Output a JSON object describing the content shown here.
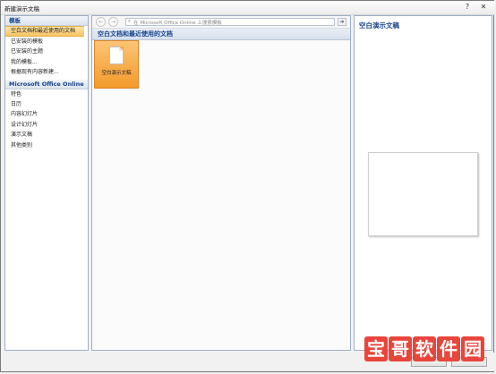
{
  "window": {
    "title": "新建演示文稿",
    "help_glyph": "?",
    "close_glyph": "✕"
  },
  "sidebar": {
    "templates_header": "模板",
    "items": [
      {
        "label": "空白文档和最近使用的文档",
        "selected": true
      },
      {
        "label": "已安装的模板"
      },
      {
        "label": "已安装的主题"
      },
      {
        "label": "我的模板..."
      },
      {
        "label": "根据现有内容新建..."
      }
    ],
    "online_header": "Microsoft Office Online",
    "online_items": [
      {
        "label": "特色"
      },
      {
        "label": "日历"
      },
      {
        "label": "内容幻灯片"
      },
      {
        "label": "设计幻灯片"
      },
      {
        "label": "演示文稿"
      },
      {
        "label": "其他类别"
      }
    ]
  },
  "toolbar": {
    "back_glyph": "←",
    "forward_glyph": "→",
    "search_icon": "magnifier-icon",
    "search_placeholder": "在 Microsoft Office Online 上搜索模板",
    "go_glyph": "➔"
  },
  "main": {
    "header": "空白文档和最近使用的文档",
    "tiles": [
      {
        "label": "空白演示文稿",
        "icon": "blank-document-icon"
      }
    ]
  },
  "preview": {
    "title": "空白演示文稿"
  },
  "watermark": {
    "text": "宝哥软件园"
  },
  "colors": {
    "selected": "#f9c264",
    "header_text": "#15428b",
    "watermark": "#e8463c"
  }
}
